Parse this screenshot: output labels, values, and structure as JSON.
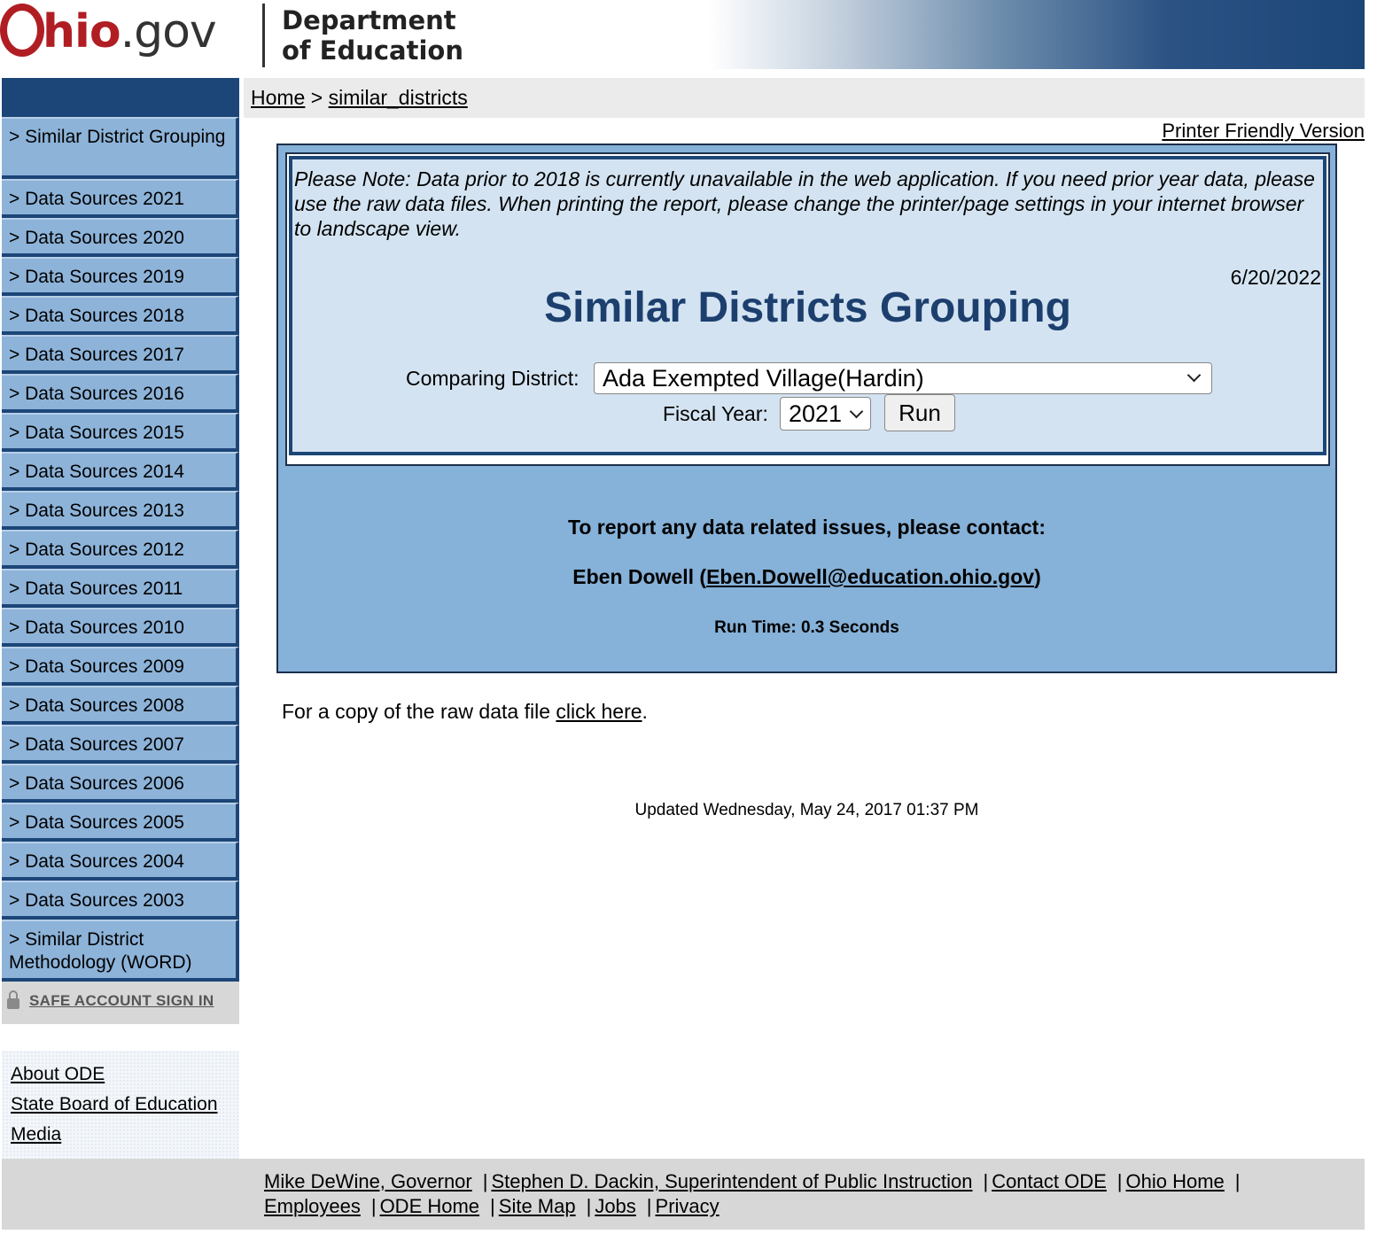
{
  "header": {
    "logo_o": "O",
    "logo_hio": "hio",
    "logo_gov": ".gov",
    "dept_line1": "Department",
    "dept_line2": "of Education"
  },
  "breadcrumb": {
    "home": "Home",
    "separator": ">",
    "current": "similar_districts"
  },
  "printer_friendly": "Printer Friendly Version",
  "sidebar": {
    "items": [
      "> Similar District Grouping",
      "> Data Sources 2021",
      "> Data Sources 2020",
      "> Data Sources 2019",
      "> Data Sources 2018",
      "> Data Sources 2017",
      "> Data Sources 2016",
      "> Data Sources 2015",
      "> Data Sources 2014",
      "> Data Sources 2013",
      "> Data Sources 2012",
      "> Data Sources 2011",
      "> Data Sources 2010",
      "> Data Sources 2009",
      "> Data Sources 2008",
      "> Data Sources 2007",
      "> Data Sources 2006",
      "> Data Sources 2005",
      "> Data Sources 2004",
      "> Data Sources 2003",
      "> Similar District Methodology (WORD)"
    ],
    "safe_sign_in": "SAFE ACCOUNT SIGN IN",
    "safe_icon": "lock-icon",
    "links": [
      "About ODE",
      "State Board of Education",
      "Media"
    ]
  },
  "main": {
    "note": "Please Note:  Data prior to 2018 is currently unavailable in the web application. If you need prior year data, please use the raw data files. When printing the report, please change the printer/page settings in your internet browser to landscape view.",
    "date": "6/20/2022",
    "title": "Similar Districts Grouping",
    "district_label": "Comparing District:",
    "district_value": "Ada Exempted Village(Hardin)",
    "fiscal_label": "Fiscal Year:",
    "fiscal_value": "2021",
    "run_label": "Run",
    "contact_heading": "To report any data related issues, please contact:",
    "contact_name": "Eben Dowell (",
    "contact_email": "Eben.Dowell@education.ohio.gov",
    "contact_close": ")",
    "run_time": "Run Time: 0.3 Seconds"
  },
  "raw_data": {
    "prefix": "For a copy of the raw data file ",
    "link": "click here",
    "suffix": "."
  },
  "updated": "Updated Wednesday, May 24, 2017 01:37 PM",
  "footer": {
    "links": [
      "Mike DeWine, Governor",
      "Stephen D. Dackin, Superintendent of Public Instruction",
      "Contact ODE",
      "Ohio Home",
      "Employees",
      "ODE Home",
      "Site Map",
      "Jobs",
      "Privacy"
    ],
    "separator": "|"
  },
  "colors": {
    "navy": "#1c4678",
    "sidebar_blue": "#8db3d9",
    "panel_light": "#d3e3f1",
    "panel_mid": "#86b1d8",
    "title_blue": "#1c3f6e",
    "logo_red": "#b01e23"
  }
}
